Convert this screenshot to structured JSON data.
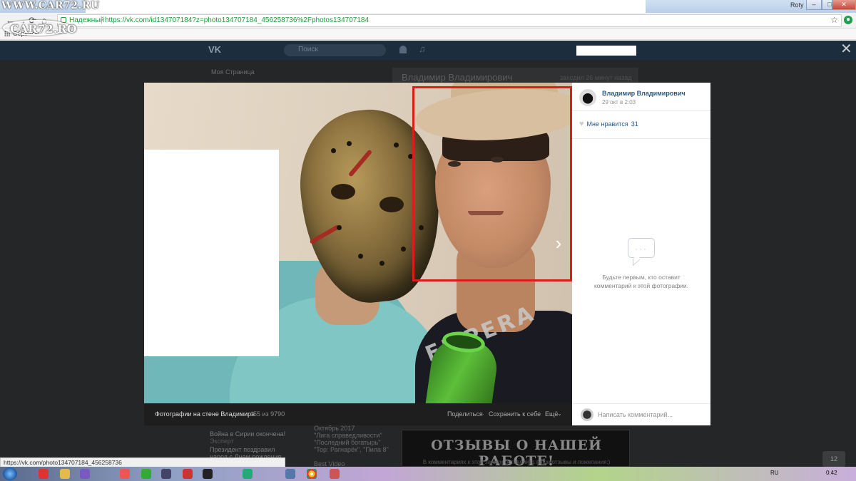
{
  "watermarks": {
    "top": "WWW.CAR72.RU",
    "logo": "CAR72.RO"
  },
  "window": {
    "user": "Roty"
  },
  "browser": {
    "security_label": "Надежный",
    "url": "https://vk.com/id134707184?z=photo134707184_456258736%2Fphotos134707184",
    "bookmarks_label": "Сервисы"
  },
  "vk_header": {
    "logo": "VK",
    "search_placeholder": "Поиск"
  },
  "background_page": {
    "sidebar": [
      "Моя Страница"
    ],
    "profile_name": "Владимир Владимирович",
    "profile_meta": "заходил 26 минут назад",
    "news": [
      "Война в Сирии окончена!",
      "Президент поздравил",
      "народ с Днем рождения",
      "Эксперт",
      "Октябрь 2017",
      "\"Лига справедливости\"",
      "\"Последний богатырь\"",
      "\"Тор: Рагнарёк\", \"Пила 8\"",
      "Best Video"
    ],
    "reviews_title": "ОТЗЫВЫ О НАШЕЙ РАБОТЕ!",
    "reviews_sub": "В комментариях к этой записи оставляйте ваши отзывы и пожелания:)",
    "counter": "12"
  },
  "viewer": {
    "album_name": "Фотографии на стене Владимира",
    "album_count": "455 из 9790",
    "actions": [
      "Поделиться",
      "Сохранить к себе",
      "Ещё"
    ],
    "tee_print": "EMPERA",
    "author": "Владимир Владимирович",
    "date": "29 окт в 2:03",
    "like_label": "Мне нравится",
    "like_count": "31",
    "empty_comments": "Будьте первым, кто оставит комментарий к этой фотографии.",
    "comment_placeholder": "Написать комментарий..."
  },
  "status_url": "https://vk.com/photo134707184_456258736",
  "taskbar": {
    "lang": "RU",
    "clock": "0:42"
  },
  "colors": {
    "accent_link": "#2a5885",
    "highlight_frame": "#e01b1b",
    "vk_header": "#1c2d3d"
  }
}
